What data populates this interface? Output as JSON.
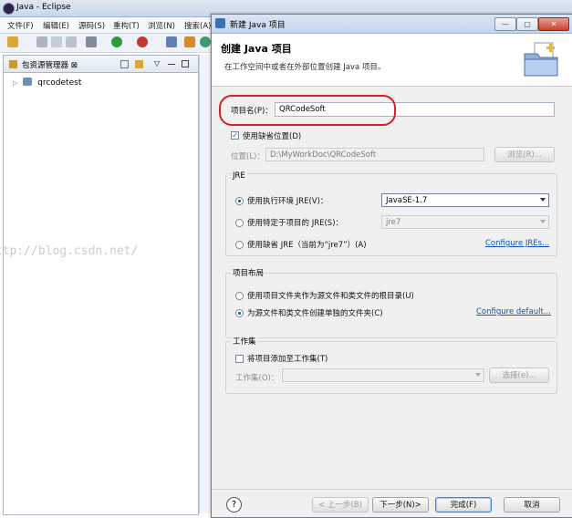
{
  "eclipse": {
    "window_title": "Java - Eclipse",
    "menu": [
      "文件(F)",
      "编辑(E)",
      "源码(S)",
      "重构(T)",
      "浏览(N)",
      "搜索(A)"
    ],
    "package_explorer": {
      "tab_label": "包资源管理器 ⊠",
      "project": "qrcodetest"
    }
  },
  "dialog": {
    "title": "新建 Java 项目",
    "header_title": "创建 Java 项目",
    "header_desc": "在工作空间中或者在外部位置创建 Java 项目。",
    "project_name_label": "项目名(P)：",
    "project_name_value": "QRCodeSoft",
    "use_default_location_label": "使用缺省位置(D)",
    "use_default_location_checked": true,
    "location_label": "位置(L)：",
    "location_value": "D:\\MyWorkDoc\\QRCodeSoft",
    "browse_label": "浏览(R)...",
    "jre": {
      "group_title": "JRE",
      "opt_exec_env": "使用执行环境 JRE(V)：",
      "exec_env_value": "JavaSE-1.7",
      "opt_project_jre": "使用特定于项目的 JRE(S)：",
      "project_jre_value": "jre7",
      "opt_default_jre": "使用缺省 JRE（当前为“jre7”）(A)",
      "configure_jres": "Configure JREs...",
      "selected": "exec_env"
    },
    "layout": {
      "group_title": "项目布局",
      "opt_single_folder": "使用项目文件夹作为源文件和类文件的根目录(U)",
      "opt_separate_folders": "为源文件和类文件创建单独的文件夹(C)",
      "configure_default": "Configure default...",
      "selected": "separate"
    },
    "working_sets": {
      "group_title": "工作集",
      "add_label": "将项目添加至工作集(T)",
      "add_checked": false,
      "sets_label": "工作集(O)：",
      "select_label": "选择(e)..."
    },
    "buttons": {
      "back": "< 上一步(B)",
      "next": "下一步(N)>",
      "finish": "完成(F)",
      "cancel": "取消"
    },
    "window_controls": [
      "—",
      "▢",
      "✕"
    ]
  },
  "watermark": "http://blog.csdn.net/"
}
